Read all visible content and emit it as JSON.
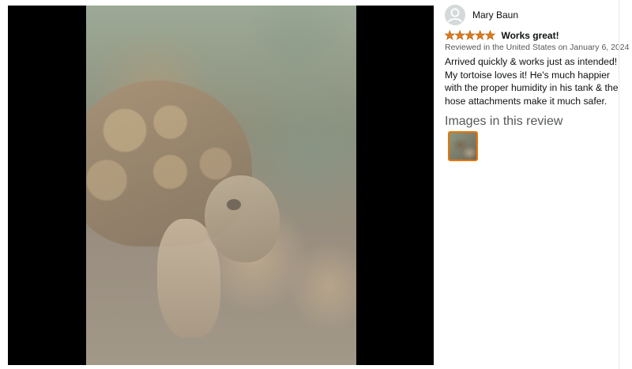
{
  "review": {
    "reviewer_name": "Mary Baun",
    "rating": 5,
    "rating_max": 5,
    "star_color": "#de7921",
    "title": "Works great!",
    "meta": "Reviewed in the United States on January 6, 2024",
    "body": "Arrived quickly & works just as intended! My tortoise loves it! He's much happier with the proper humidity in his tank & the hose attachments make it much safer.",
    "images_heading": "Images in this review",
    "thumbnail_border_color": "#e77600"
  },
  "icons": {
    "avatar": "default-user-avatar-icon",
    "star": "star-icon"
  }
}
